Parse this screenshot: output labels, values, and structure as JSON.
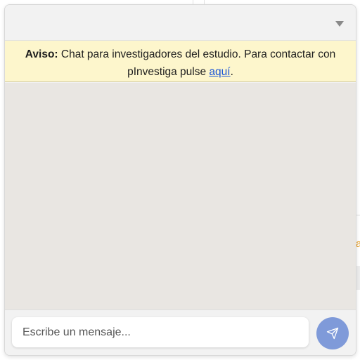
{
  "notice": {
    "label": "Aviso:",
    "text": " Chat para investigadores del estudio. Para contactar con pInvestiga pulse ",
    "link_text": "aquí",
    "end": "."
  },
  "composer": {
    "placeholder": "Escribe un mensaje..."
  },
  "background_fragment": {
    "letter": "a"
  },
  "icons": {
    "header": "chevron-down-icon",
    "send": "send-icon"
  },
  "colors": {
    "notice_bg": "#fdf6cc",
    "link": "#1a55d6",
    "send_button": "#7f9ad9",
    "messages_bg": "#e9e6e2"
  }
}
